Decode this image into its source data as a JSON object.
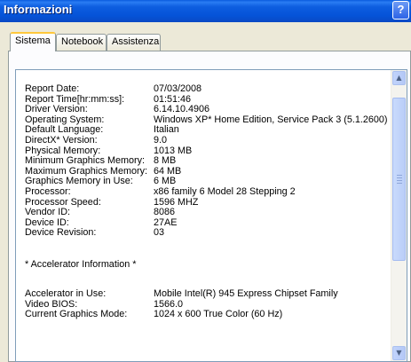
{
  "window": {
    "title": "Informazioni",
    "help_label": "?"
  },
  "tabs": [
    {
      "label": "Sistema",
      "active": true
    },
    {
      "label": "Notebook",
      "active": false
    },
    {
      "label": "Assistenza",
      "active": false
    }
  ],
  "info": {
    "rows": [
      {
        "label": "Report Date:",
        "value": "07/03/2008"
      },
      {
        "label": "Report Time[hr:mm:ss]:",
        "value": "01:51:46"
      },
      {
        "label": "Driver Version:",
        "value": "6.14.10.4906"
      },
      {
        "label": "Operating System:",
        "value": "Windows XP* Home Edition, Service Pack 3 (5.1.2600)"
      },
      {
        "label": "Default Language:",
        "value": "Italian"
      },
      {
        "label": "DirectX* Version:",
        "value": "9.0"
      },
      {
        "label": "Physical Memory:",
        "value": "1013 MB"
      },
      {
        "label": "Minimum Graphics Memory:",
        "value": "8 MB"
      },
      {
        "label": "Maximum Graphics Memory:",
        "value": "64 MB"
      },
      {
        "label": "Graphics Memory in Use:",
        "value": "6 MB"
      },
      {
        "label": "Processor:",
        "value": "x86 family 6 Model 28 Stepping 2"
      },
      {
        "label": "Processor Speed:",
        "value": "1596 MHZ"
      },
      {
        "label": "Vendor ID:",
        "value": "8086"
      },
      {
        "label": "Device ID:",
        "value": "27AE"
      },
      {
        "label": "Device Revision:",
        "value": "03"
      }
    ],
    "section_title": "*   Accelerator Information   *",
    "accel_rows": [
      {
        "label": "Accelerator in Use:",
        "value": "Mobile Intel(R) 945 Express Chipset Family"
      },
      {
        "label": "Video BIOS:",
        "value": "1566.0"
      },
      {
        "label": "Current Graphics Mode:",
        "value": "1024 x 600 True Color (60 Hz)"
      }
    ]
  },
  "scrollbar": {
    "up_icon": "▲",
    "down_icon": "▼"
  }
}
